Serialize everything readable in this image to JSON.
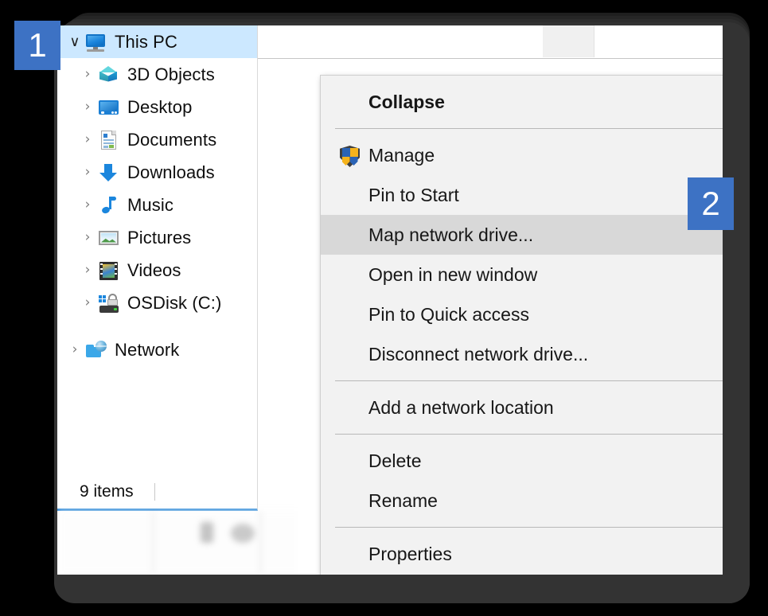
{
  "window": {
    "app": "File Explorer",
    "status_text": "9 items"
  },
  "nav_tree": {
    "items": [
      {
        "label": "This PC",
        "icon": "this-pc-icon",
        "expander": "chevron-down-icon",
        "selected": true,
        "indent": 0
      },
      {
        "label": "3D Objects",
        "icon": "3d-objects-icon",
        "expander": "chevron-right-icon",
        "selected": false,
        "indent": 1
      },
      {
        "label": "Desktop",
        "icon": "desktop-icon",
        "expander": "chevron-right-icon",
        "selected": false,
        "indent": 1
      },
      {
        "label": "Documents",
        "icon": "documents-icon",
        "expander": "chevron-right-icon",
        "selected": false,
        "indent": 1
      },
      {
        "label": "Downloads",
        "icon": "downloads-icon",
        "expander": "chevron-right-icon",
        "selected": false,
        "indent": 1
      },
      {
        "label": "Music",
        "icon": "music-icon",
        "expander": "chevron-right-icon",
        "selected": false,
        "indent": 1
      },
      {
        "label": "Pictures",
        "icon": "pictures-icon",
        "expander": "chevron-right-icon",
        "selected": false,
        "indent": 1
      },
      {
        "label": "Videos",
        "icon": "videos-icon",
        "expander": "chevron-right-icon",
        "selected": false,
        "indent": 1
      },
      {
        "label": "OSDisk (C:)",
        "icon": "osdisk-icon",
        "expander": "chevron-right-icon",
        "selected": false,
        "indent": 1
      },
      {
        "label": "Network",
        "icon": "network-icon",
        "expander": "chevron-right-icon",
        "selected": false,
        "indent": 0
      }
    ],
    "chevron_right_glyph": "›",
    "chevron_down_glyph": "∨"
  },
  "context_menu": {
    "items": [
      {
        "label": "Collapse",
        "bold": true,
        "icon": null,
        "highlight": false
      },
      {
        "type": "separator"
      },
      {
        "label": "Manage",
        "bold": false,
        "icon": "uac-shield-icon",
        "highlight": false
      },
      {
        "label": "Pin to Start",
        "bold": false,
        "icon": null,
        "highlight": false
      },
      {
        "label": "Map network drive...",
        "bold": false,
        "icon": null,
        "highlight": true
      },
      {
        "label": "Open in new window",
        "bold": false,
        "icon": null,
        "highlight": false
      },
      {
        "label": "Pin to Quick access",
        "bold": false,
        "icon": null,
        "highlight": false
      },
      {
        "label": "Disconnect network drive...",
        "bold": false,
        "icon": null,
        "highlight": false
      },
      {
        "type": "separator"
      },
      {
        "label": "Add a network location",
        "bold": false,
        "icon": null,
        "highlight": false
      },
      {
        "type": "separator"
      },
      {
        "label": "Delete",
        "bold": false,
        "icon": null,
        "highlight": false
      },
      {
        "label": "Rename",
        "bold": false,
        "icon": null,
        "highlight": false
      },
      {
        "type": "separator"
      },
      {
        "label": "Properties",
        "bold": false,
        "icon": null,
        "highlight": false
      }
    ]
  },
  "badges": [
    {
      "number": "1",
      "target": "this-pc-tree-item"
    },
    {
      "number": "2",
      "target": "map-network-drive-menu-item"
    }
  ],
  "colors": {
    "badge_blue": "#3d72c4",
    "selection_blue": "#cce8ff",
    "menu_background": "#f2f2f2",
    "menu_highlight": "#d8d8d8",
    "accent_border": "#1b7fd4"
  }
}
